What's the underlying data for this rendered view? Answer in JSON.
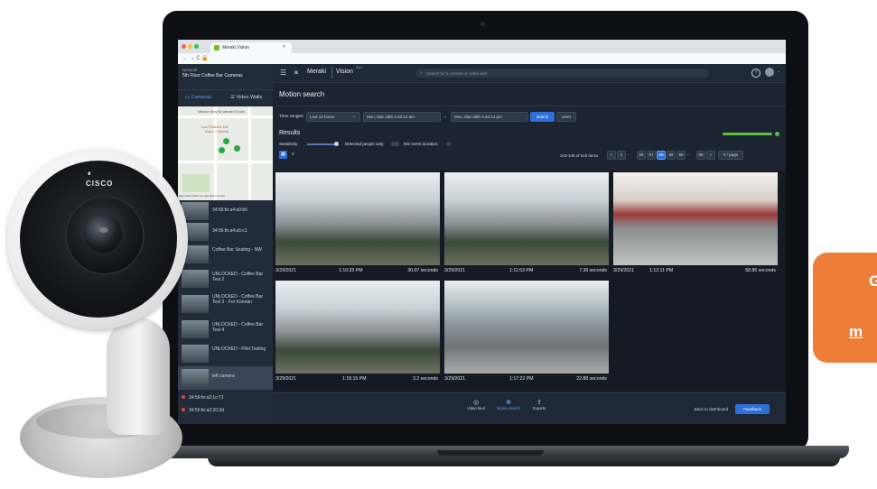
{
  "browser": {
    "tab_title": "Meraki Vision",
    "tab_close": "×",
    "nav": "← → C 🔒"
  },
  "sidebar": {
    "network_label": "Network",
    "network_name": "5th Floor Coffee Bar Cameras",
    "tab_cameras": "Cameras",
    "tab_video_walls": "Video Walls",
    "map": {
      "street_label": "Mission Bay Boulevard South",
      "place_label_1": "Los Poderes Del",
      "place_label_2": "Amor Y Suerte",
      "footer": "Map data ©2021 Google   Terms of Use"
    },
    "cameras": [
      {
        "label": "34:56:fe:a4:a0:b6"
      },
      {
        "label": "34:56:fe:a4:a5:c1"
      },
      {
        "label": "Coffee Bar Seating - NW"
      },
      {
        "label": "UNLOCKED - Coffee Bar Test 2"
      },
      {
        "label": "UNLOCKED - Coffee Bar Test 3 - For Konnan"
      },
      {
        "label": "UNLOCKED - Coffee Bar Test 4"
      },
      {
        "label": "UNLOCKED - Pilot Testing"
      },
      {
        "label": "left camera"
      },
      {
        "label": "34:56:fe:a2:1c:71"
      },
      {
        "label": "34:56:fe:a2:20:3d"
      }
    ]
  },
  "topbar": {
    "brand": "Meraki",
    "product": "Vision",
    "beta": "Beta",
    "search_placeholder": "Search for a camera or video wall"
  },
  "page": {
    "title": "Motion search",
    "time_ranges_label": "Time ranges:",
    "time_range_value": "Last 12 hours",
    "start": "Mon, Mar 29th  4:40:13 am",
    "end": "Mon, Mar 29th  4:40:13 pm",
    "search_btn": "search",
    "reset_btn": "reset",
    "results_title": "Results",
    "sensitivity_label": "Sensitivity:",
    "detected_people_label": "Detected people only:",
    "min_event_label": "Min event duration:",
    "items_range": "343-348 of 515 items",
    "pagination": [
      "<",
      "1",
      "...",
      "56",
      "57",
      "58",
      "59",
      "60",
      "...",
      "86",
      ">"
    ],
    "active_page": "58",
    "per_page": "6 / page"
  },
  "results": [
    {
      "date": "3/29/2021",
      "time": "1:10:33 PM",
      "duration": "30.07 seconds"
    },
    {
      "date": "3/29/2021",
      "time": "1:11:53 PM",
      "duration": "7.39 seconds"
    },
    {
      "date": "3/29/2021",
      "time": "1:12:11 PM",
      "duration": "58.86 seconds"
    },
    {
      "date": "3/29/2021",
      "time": "1:16:15 PM",
      "duration": "3.2 seconds"
    },
    {
      "date": "3/29/2021",
      "time": "1:17:22 PM",
      "duration": "22.88 seconds"
    }
  ],
  "bottom": {
    "video_feed": "Video feed",
    "motion_search": "Motion search",
    "exports": "Exports",
    "back_btn": "Back to dashboard",
    "feedback_btn": "Feedback"
  },
  "camera_device": {
    "brand": "CISCO"
  },
  "promo": {
    "line1": "G",
    "line2": "m"
  },
  "colors": {
    "accent_green": "#5cc23d",
    "accent_blue": "#2f6fd8",
    "promo_orange": "#ee7d3a"
  }
}
